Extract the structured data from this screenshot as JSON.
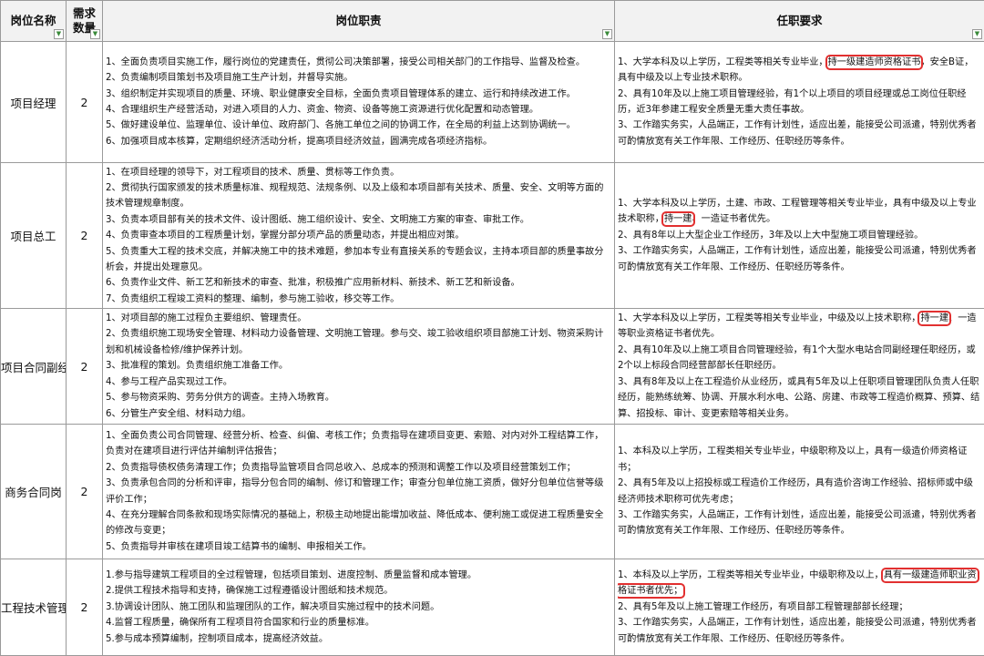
{
  "header": {
    "name": "岗位名称",
    "count": "需求数量",
    "duty": "岗位职责",
    "req": "任职要求"
  },
  "rows": [
    {
      "name": "项目经理",
      "count": "2",
      "duty": [
        "1、全面负责项目实施工作，履行岗位的党建责任，贯彻公司决策部署，接受公司相关部门的工作指导、监督及检查。",
        "2、负责编制项目策划书及项目施工生产计划，并督导实施。",
        "3、组织制定并实现项目的质量、环境、职业健康安全目标，全面负责项目管理体系的建立、运行和持续改进工作。",
        "4、合理组织生产经营活动，对进入项目的人力、资金、物资、设备等施工资源进行优化配置和动态管理。",
        "5、做好建设单位、监理单位、设计单位、政府部门、各施工单位之间的协调工作，在全局的利益上达到协调统一。",
        "6、加强项目成本核算，定期组织经济活动分析，提高项目经济效益，圆满完成各项经济指标。"
      ],
      "req": [
        [
          "1、大学本科及以上学历，工程类等相关专业毕业，",
          "持一级建造师资格证书",
          "，安全B证，具有中级及以上专业技术职称。"
        ],
        [
          "2、具有10年及以上施工项目管理经验，有1个以上项目的项目经理或总工岗位任职经历，近3年参建工程安全质量无重大责任事故。"
        ],
        [
          "3、工作踏实务实，人品端正，工作有计划性，适应出差，能接受公司派遣，特别优秀者可酌情放宽有关工作年限、工作经历、任职经历等条件。"
        ]
      ]
    },
    {
      "name": "项目总工",
      "count": "2",
      "duty": [
        "1、在项目经理的领导下，对工程项目的技术、质量、贯标等工作负责。",
        "2、贯彻执行国家颁发的技术质量标准、规程规范、法规条例、以及上级和本项目部有关技术、质量、安全、文明等方面的技术管理规章制度。",
        "3、负责本项目部有关的技术文件、设计图纸、施工组织设计、安全、文明施工方案的审查、审批工作。",
        "4、负责审查本项目的工程质量计划，掌握分部分项产品的质量动态，并提出相应对策。",
        "5、负责重大工程的技术交底，并解决施工中的技术难题，参加本专业有直接关系的专题会议，主持本项目部的质量事故分析会，并提出处理意见。",
        "6、负责作业文件、新工艺和新技术的审查、批准，积极推广应用新材料、新技术、新工艺和新设备。",
        "7、负责组织工程竣工资料的整理、编制，参与施工验收，移交等工作。"
      ],
      "req": [
        [
          "1、大学本科及以上学历，土建、市政、工程管理等相关专业毕业，具有中级及以上专业技术职称，",
          "持一建",
          "、一造证书者优先。"
        ],
        [
          "2、具有8年以上大型企业工作经历，3年及以上大中型施工项目管理经验。"
        ],
        [
          "3、工作踏实务实，人品端正，工作有计划性，适应出差，能接受公司派遣，特别优秀者可酌情放宽有关工作年限、工作经历、任职经历等条件。"
        ]
      ]
    },
    {
      "name": "项目合同副经理",
      "count": "2",
      "duty": [
        "1、对项目部的施工过程负主要组织、管理责任。",
        "2、负责组织施工现场安全管理、材料动力设备管理、文明施工管理。参与交、竣工验收组织项目部施工计划、物资采购计划和机械设备检修/维护保养计划。",
        "3、批准程的策划。负责组织施工准备工作。",
        "4、参与工程产品实现过工作。",
        "5、参与物资采购、劳务分供方的调查。主持入场教育。",
        "6、分管生产安全组、材料动力组。"
      ],
      "req": [
        [
          "1、大学本科及以上学历，工程类等相关专业毕业，中级及以上技术职称，",
          "持一建",
          "、一造等职业资格证书者优先。"
        ],
        [
          "2、具有10年及以上施工项目合同管理经验，有1个大型水电站合同副经理任职经历，或2个以上标段合同经营部部长任职经历。"
        ],
        [
          "3、具有8年及以上在工程造价从业经历，或具有5年及以上任职项目管理团队负责人任职经历，能熟练统筹、协调、开展水利水电、公路、房建、市政等工程造价概算、预算、结算、招投标、审计、变更索赔等相关业务。"
        ]
      ]
    },
    {
      "name": "商务合同岗",
      "count": "2",
      "duty": [
        "1、全面负责公司合同管理、经营分析、检查、纠偏、考核工作；负责指导在建项目变更、索赔、对内对外工程结算工作，负责对在建项目进行评估并编制评估报告；",
        "2、负责指导债权债务清理工作；负责指导监管项目合同总收入、总成本的预测和调整工作以及项目经营策划工作；",
        "3、负责承包合同的分析和评审，指导分包合同的编制、修订和管理工作；审查分包单位施工资质，做好分包单位信誉等级评价工作；",
        "4、在充分理解合同条款和现场实际情况的基础上，积极主动地提出能增加收益、降低成本、便利施工或促进工程质量安全的修改与变更；",
        "5、负责指导并审核在建项目竣工结算书的编制、申报相关工作。"
      ],
      "req": [
        [
          "1、本科及以上学历，工程类相关专业毕业，中级职称及以上，具有一级造价师资格证书；"
        ],
        [
          "2、具有5年及以上招投标或工程造价工作经历，具有造价咨询工作经验、招标师或中级经济师技术职称可优先考虑；"
        ],
        [
          "3、工作踏实务实，人品端正，工作有计划性，适应出差，能接受公司派遣，特别优秀者可酌情放宽有关工作年限、工作经历、任职经历等条件。"
        ]
      ]
    },
    {
      "name": "工程技术管理岗",
      "count": "2",
      "duty": [
        "1.参与指导建筑工程项目的全过程管理，包括项目策划、进度控制、质量监督和成本管理。",
        "2.提供工程技术指导和支持，确保施工过程遵循设计图纸和技术规范。",
        "3.协调设计团队、施工团队和监理团队的工作，解决项目实施过程中的技术问题。",
        "4.监督工程质量，确保所有工程项目符合国家和行业的质量标准。",
        "5.参与成本预算编制，控制项目成本，提高经济效益。"
      ],
      "req": [
        [
          "1、本科及以上学历，工程类等相关专业毕业，中级职称及以上，",
          "具有一级建造师职业资格证书者优先；"
        ],
        [
          "2、具有5年及以上施工管理工作经历，有项目部工程管理部部长经理；"
        ],
        [
          "3、工作踏实务实，人品端正，工作有计划性，适应出差，能接受公司派遣，特别优秀者可酌情放宽有关工作年限、工作经历、任职经历等条件。"
        ]
      ]
    }
  ]
}
